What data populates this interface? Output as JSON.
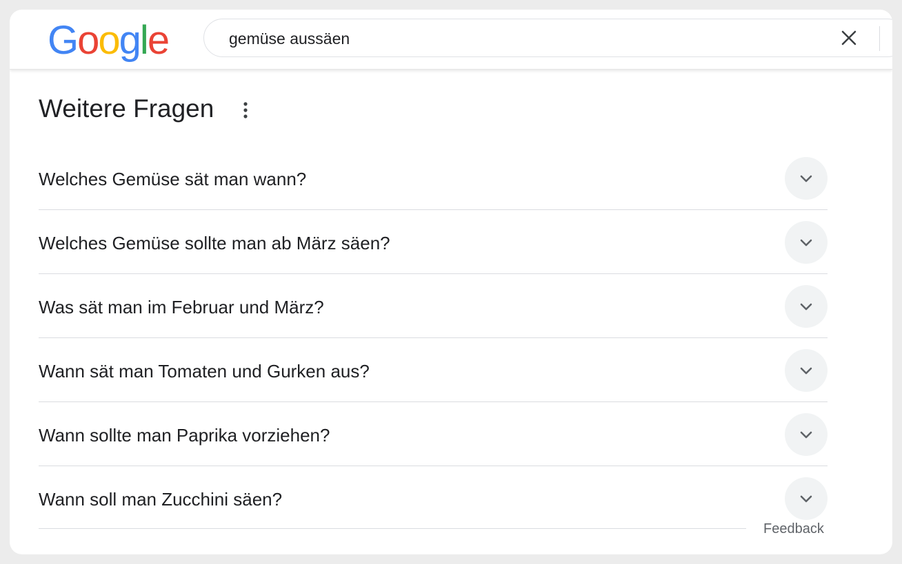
{
  "header": {
    "logo": {
      "letters": [
        "G",
        "o",
        "o",
        "g",
        "l",
        "e"
      ],
      "colors": [
        "#4285F4",
        "#EA4335",
        "#FBBC05",
        "#4285F4",
        "#34A853",
        "#EA4335"
      ]
    },
    "search": {
      "value": "gemüse aussäen"
    },
    "clear_icon": "close-icon"
  },
  "section": {
    "title": "Weitere Fragen",
    "more_icon": "more-vertical-icon",
    "questions": [
      "Welches Gemüse sät man wann?",
      "Welches Gemüse sollte man ab März säen?",
      "Was sät man im Februar und März?",
      "Wann sät man Tomaten und Gurken aus?",
      "Wann sollte man Paprika vorziehen?",
      "Wann soll man Zucchini säen?"
    ],
    "expand_icon": "chevron-down-icon",
    "feedback_label": "Feedback"
  }
}
